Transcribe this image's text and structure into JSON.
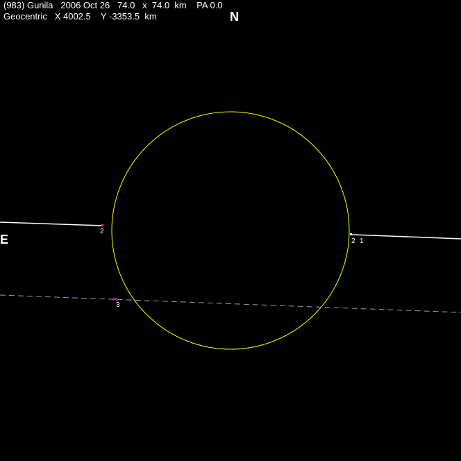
{
  "header": {
    "line1": "(983) Gunila   2006 Oct 26   74.0   x  74.0  km    PA 0.0",
    "line2": "Geocentric   X 4002.5    Y -3353.5  km"
  },
  "directions": {
    "north": "N",
    "east": "E"
  },
  "colors": {
    "background": "#000000",
    "asteroid_outline": "#ffff00",
    "positive_chord": "#ffffff",
    "miss_chord": "#9a9ab4",
    "marker": "#ff3333",
    "miss_marker": "#ff44cc"
  },
  "chord_labels": {
    "left_west_chord": "2",
    "right_chord_first": "2",
    "right_chord_second": "1",
    "miss_chord": "3"
  }
}
